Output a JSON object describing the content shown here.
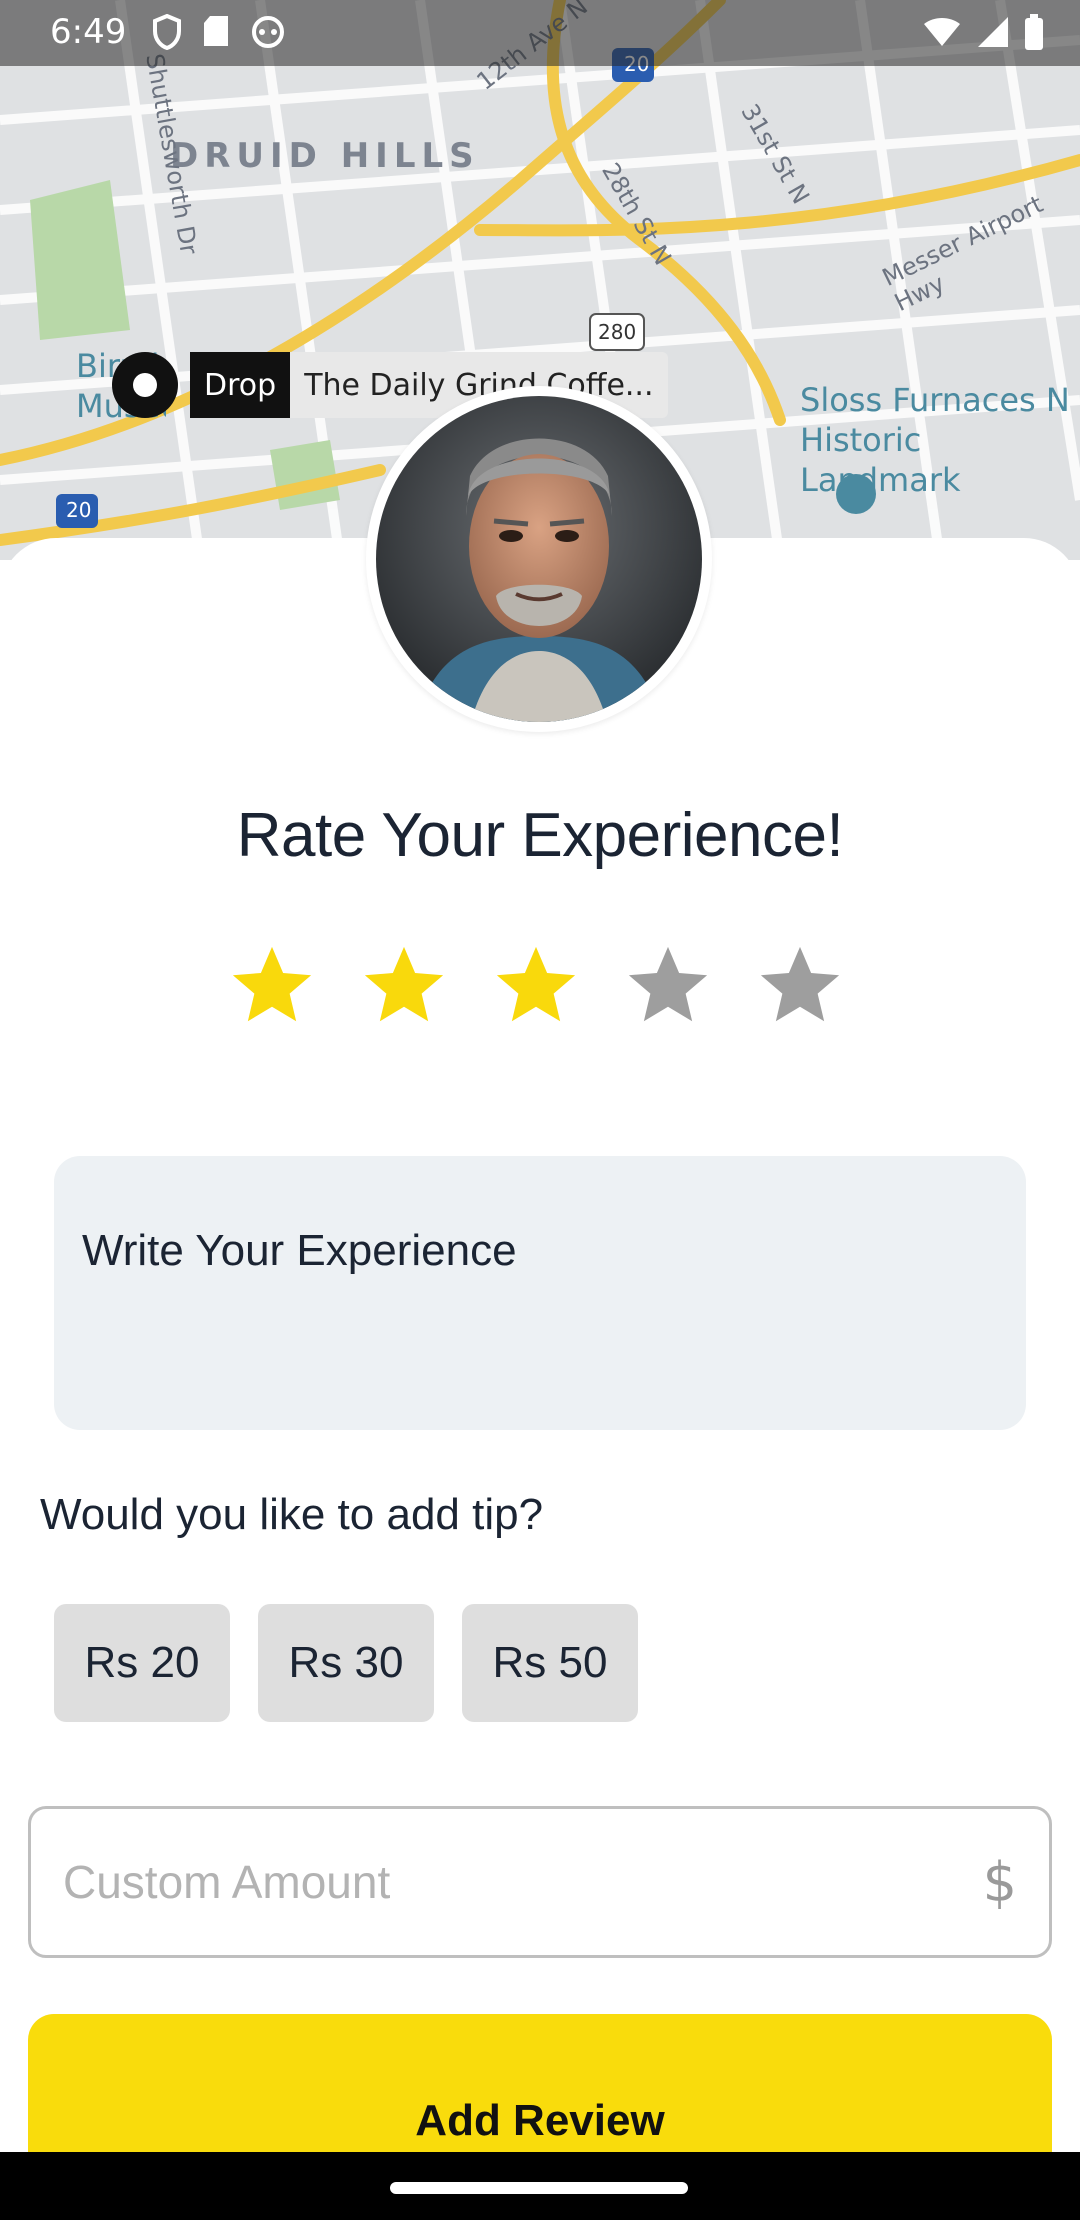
{
  "status_bar": {
    "time": "6:49",
    "left_icons": [
      "shield-icon",
      "sd-card-icon",
      "android-icon"
    ],
    "right_icons": [
      "wifi-icon",
      "signal-icon",
      "battery-icon"
    ]
  },
  "map": {
    "district_label": "DRUID HILLS",
    "street_labels": [
      "12th Ave N",
      "Shuttlesworth Dr",
      "28th St N",
      "31st St N",
      "Messer Airport Hwy"
    ],
    "highway_shields": [
      "20",
      "280",
      "20"
    ],
    "poi_left": "Birmingham Museum",
    "poi_right_line1": "Sloss Furnaces N",
    "poi_right_line2": "Historic Landmark",
    "drop_tag": "Drop",
    "drop_place": "The Daily Grind Coffe..."
  },
  "rating": {
    "title": "Rate Your Experience!",
    "value": 3,
    "max": 5,
    "filled_color": "#F9D90C",
    "empty_color": "#9E9E9E"
  },
  "experience": {
    "placeholder": "Write Your Experience"
  },
  "tip": {
    "question": "Would you like to add tip?",
    "options": [
      "Rs 20",
      "Rs 30",
      "Rs 50"
    ],
    "custom_placeholder": "Custom Amount",
    "currency_symbol": "$"
  },
  "submit": {
    "label": "Add Review",
    "color": "#F9DC0C"
  }
}
